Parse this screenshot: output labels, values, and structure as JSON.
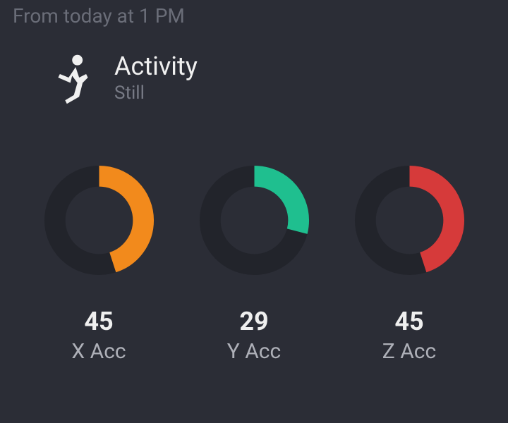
{
  "timestamp": "From today at 1 PM",
  "activity": {
    "title": "Activity",
    "status": "Still"
  },
  "gauges": [
    {
      "value": 45,
      "label": "X Acc",
      "color": "#f28a1c"
    },
    {
      "value": 29,
      "label": "Y Acc",
      "color": "#1fbf8f"
    },
    {
      "value": 45,
      "label": "Z Acc",
      "color": "#d63a3a"
    }
  ],
  "chart_data": [
    {
      "type": "pie",
      "title": "X Acc",
      "categories": [
        "value",
        "remaining"
      ],
      "values": [
        45,
        55
      ],
      "colors": [
        "#f28a1c",
        "#22242b"
      ]
    },
    {
      "type": "pie",
      "title": "Y Acc",
      "categories": [
        "value",
        "remaining"
      ],
      "values": [
        29,
        71
      ],
      "colors": [
        "#1fbf8f",
        "#22242b"
      ]
    },
    {
      "type": "pie",
      "title": "Z Acc",
      "categories": [
        "value",
        "remaining"
      ],
      "values": [
        45,
        55
      ],
      "colors": [
        "#d63a3a",
        "#22242b"
      ]
    }
  ]
}
